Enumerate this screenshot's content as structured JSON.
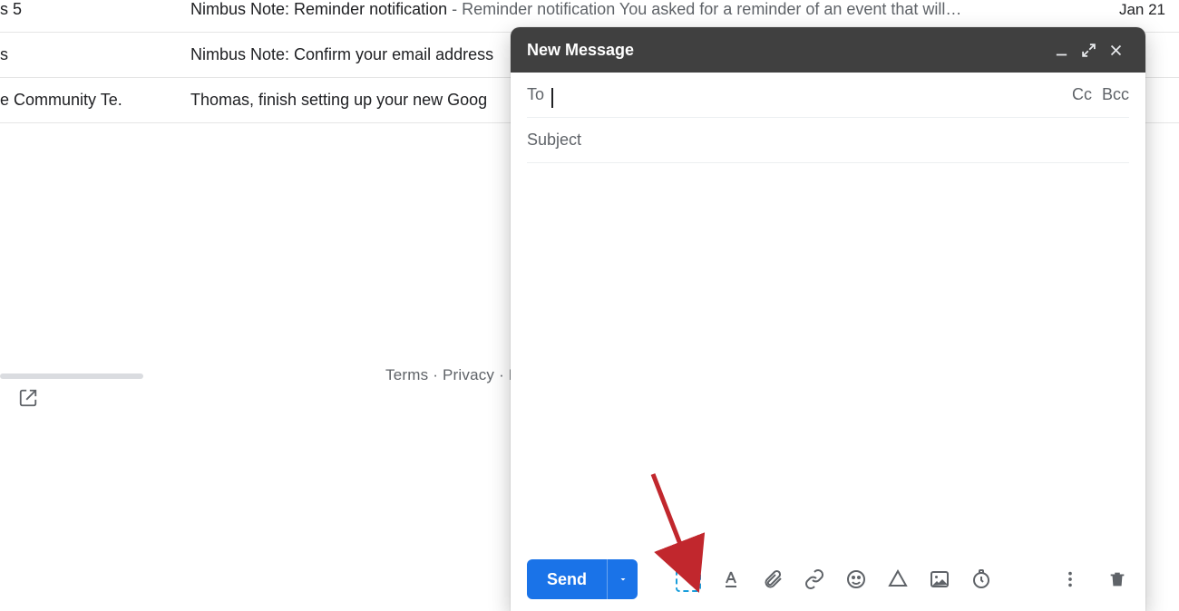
{
  "inbox": {
    "rows": [
      {
        "sender": "s 5",
        "subject": "Nimbus Note: Reminder notification",
        "preview": " - Reminder notification You asked for a reminder of an event that will…",
        "date": "Jan 21"
      },
      {
        "sender": "s",
        "subject": "Nimbus Note: Confirm your email address",
        "preview": "",
        "date": ""
      },
      {
        "sender": "e Community Te.",
        "subject": "Thomas, finish setting up your new Goog",
        "preview": "",
        "date": ""
      }
    ]
  },
  "footer": {
    "terms": "Terms",
    "privacy": "Privacy",
    "sep": " · "
  },
  "compose": {
    "title": "New Message",
    "to_label": "To",
    "cc": "Cc",
    "bcc": "Bcc",
    "subject_placeholder": "Subject",
    "send": "Send"
  }
}
